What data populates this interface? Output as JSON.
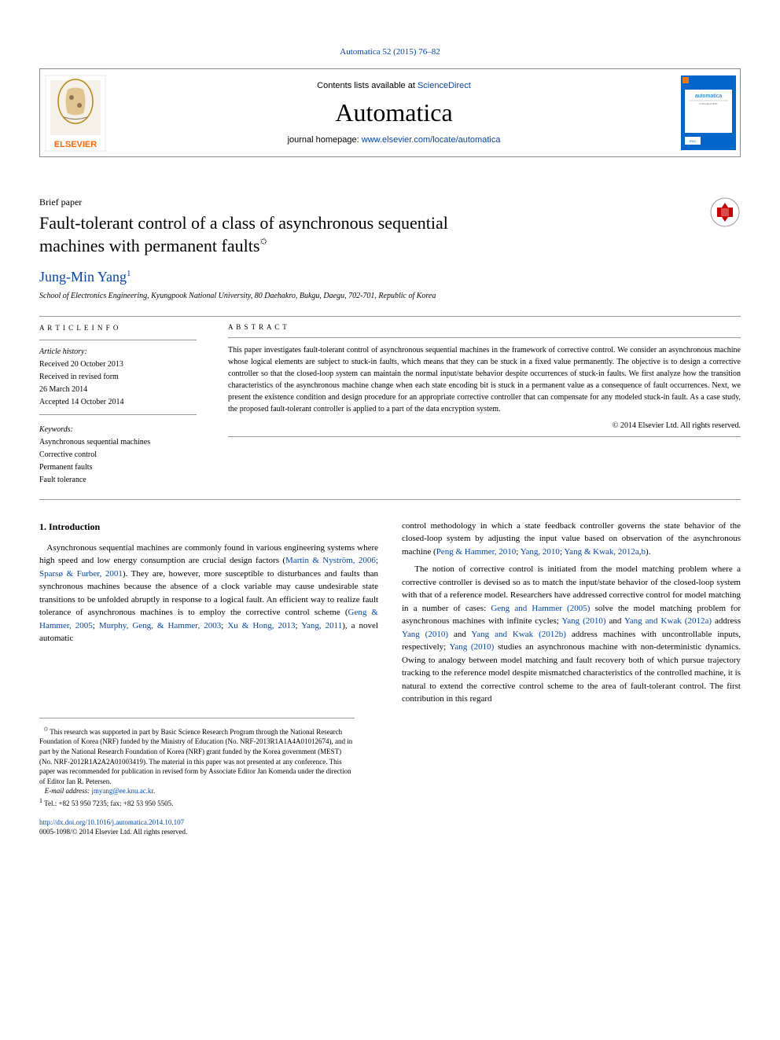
{
  "top_citation_text": "Automatica 52 (2015) 76–82",
  "header": {
    "contents_prefix": "Contents lists available at ",
    "contents_link": "ScienceDirect",
    "journal_title": "Automatica",
    "homepage_prefix": "journal homepage: ",
    "homepage_link": "www.elsevier.com/locate/automatica"
  },
  "paper": {
    "brief_label": "Brief paper",
    "title_line1": "Fault-tolerant control of a class of asynchronous sequential",
    "title_line2": "machines with permanent faults",
    "footnote_mark": "✩"
  },
  "author": {
    "name": "Jung-Min Yang",
    "sup": "1"
  },
  "affiliation": "School of Electronics Engineering, Kyungpook National University, 80 Daehakro, Bukgu, Daegu, 702-701, Republic of Korea",
  "article_info": {
    "heading": "A R T I C L E   I N F O",
    "history_label": "Article history:",
    "received": "Received 20 October 2013",
    "revised": "Received in revised form",
    "revised_date": "26 March 2014",
    "accepted": "Accepted 14 October 2014",
    "keywords_label": "Keywords:",
    "kw1": "Asynchronous sequential machines",
    "kw2": "Corrective control",
    "kw3": "Permanent faults",
    "kw4": "Fault tolerance"
  },
  "abstract": {
    "heading": "A B S T R A C T",
    "text": "This paper investigates fault-tolerant control of asynchronous sequential machines in the framework of corrective control. We consider an asynchronous machine whose logical elements are subject to stuck-in faults, which means that they can be stuck in a fixed value permanently. The objective is to design a corrective controller so that the closed-loop system can maintain the normal input/state behavior despite occurrences of stuck-in faults. We first analyze how the transition characteristics of the asynchronous machine change when each state encoding bit is stuck in a permanent value as a consequence of fault occurrences. Next, we present the existence condition and design procedure for an appropriate corrective controller that can compensate for any modeled stuck-in fault. As a case study, the proposed fault-tolerant controller is applied to a part of the data encryption system.",
    "copyright": "© 2014 Elsevier Ltd. All rights reserved."
  },
  "section1_heading": "1. Introduction",
  "col1": {
    "p1_a": "Asynchronous sequential machines are commonly found in various engineering systems where high speed and low energy consumption are crucial design factors (",
    "p1_link1": "Martin & Nyström, 2006",
    "p1_b": "; ",
    "p1_link2": "Sparsø & Furber, 2001",
    "p1_c": "). They are, however, more susceptible to disturbances and faults than synchronous machines because the absence of a clock variable may cause undesirable state transitions to be unfolded abruptly in response to a logical fault. An efficient way to realize fault tolerance of asynchronous machines is to employ the corrective control scheme (",
    "p1_link3": "Geng & Hammer, 2005",
    "p1_d": "; ",
    "p1_link4": "Murphy, Geng, & Hammer, 2003",
    "p1_e": "; ",
    "p1_link5": "Xu & Hong, 2013",
    "p1_f": "; ",
    "p1_link6": "Yang, 2011",
    "p1_g": "), a novel automatic",
    "footnote_star": "✩",
    "fn_star_text": " This research was supported in part by Basic Science Research Program through the National Research Foundation of Korea (NRF) funded by the Ministry of Education (No. NRF-2013R1A1A4A01012674), and in part by the National Research Foundation of Korea (NRF) grant funded by the Korea government (MEST) (No. NRF-2012R1A2A2A01003419). The material in this paper was not presented at any conference. This paper was recommended for publication in revised form by Associate Editor Jan Komenda under the direction of Editor Ian R. Petersen.",
    "fn_email_label": "E-mail address: ",
    "fn_email": "jmyang@ee.knu.ac.kr",
    "fn_tel": "Tel.: +82 53 950 7235; fax: +82 53 950 5505.",
    "fn_sup1": "1"
  },
  "col2": {
    "p1_a": "control methodology in which a state feedback controller governs the state behavior of the closed-loop system by adjusting the input value based on observation of the asynchronous machine (",
    "p1_link1": "Peng & Hammer, 2010",
    "p1_b": "; ",
    "p1_link2": "Yang, 2010",
    "p1_c": "; ",
    "p1_link3": "Yang & Kwak, 2012a",
    "p1_d": ",",
    "p1_link4": "b",
    "p1_e": ").",
    "p2_a": "The notion of corrective control is initiated from the model matching problem where a corrective controller is devised so as to match the input/state behavior of the closed-loop system with that of a reference model. Researchers have addressed corrective control for model matching in a number of cases: ",
    "p2_link1": "Geng and Hammer (2005)",
    "p2_b": " solve the model matching problem for asynchronous machines with infinite cycles; ",
    "p2_link2": "Yang (2010)",
    "p2_c": " and ",
    "p2_link3": "Yang and Kwak (2012a)",
    "p2_d": " address ",
    "p2_link4": "Yang (2010)",
    "p2_e": " and ",
    "p2_link5": "Yang and Kwak (2012b)",
    "p2_f": " address machines with uncontrollable inputs, respectively; ",
    "p2_link6": "Yang (2010)",
    "p2_g": " studies an asynchronous machine with non-deterministic dynamics. Owing to analogy between model matching and fault recovery both of which pursue trajectory tracking to the reference model despite mismatched characteristics of the controlled machine, it is natural to extend the corrective control scheme to the area of fault-tolerant control. The first contribution in this regard"
  },
  "doi": {
    "link": "http://dx.doi.org/10.1016/j.automatica.2014.10.107",
    "copyright": "0005-1098/© 2014 Elsevier Ltd. All rights reserved."
  }
}
